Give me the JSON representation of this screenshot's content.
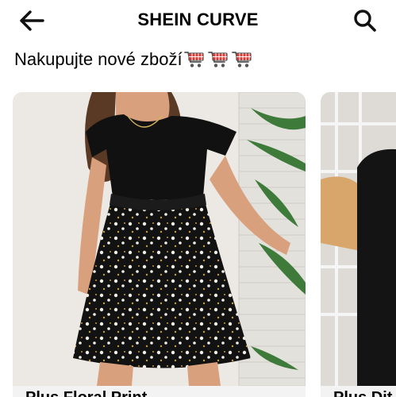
{
  "header": {
    "title": "SHEIN CURVE",
    "back_icon": "arrow-left-icon",
    "search_icon": "search-icon"
  },
  "promo": {
    "text": "Nakupujte nové zboží",
    "cart_icon": "shopping-cart-icon",
    "cart_count": 3
  },
  "products": [
    {
      "name": "Plus Floral Print..."
    },
    {
      "name": "Plus Dit..."
    }
  ],
  "colors": {
    "cart_red": "#e53935",
    "card_bg": "#f3f3f3"
  }
}
